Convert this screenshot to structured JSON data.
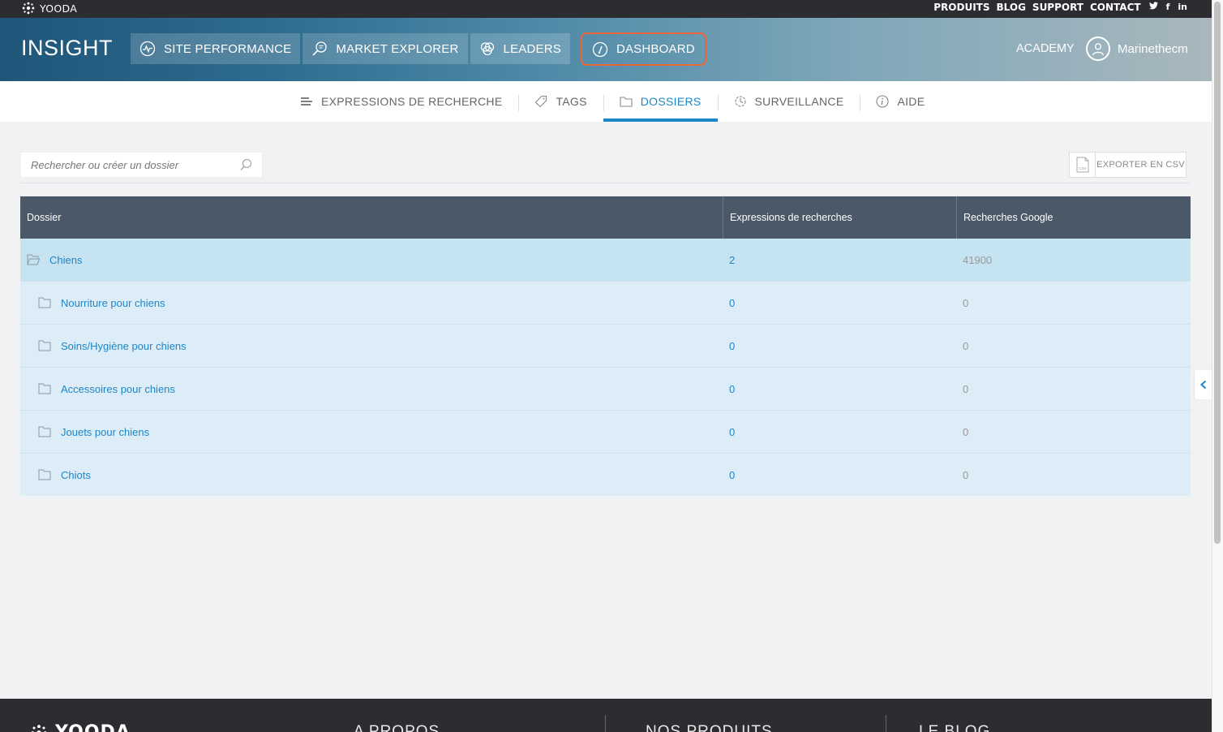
{
  "topbar": {
    "logo_text": "YOODA",
    "links": [
      "PRODUITS",
      "BLOG",
      "SUPPORT",
      "CONTACT"
    ],
    "social": [
      "twitter-icon",
      "facebook-icon",
      "linkedin-icon"
    ],
    "social_glyphs": {
      "twitter": "🐦",
      "facebook": "f",
      "linkedin": "in"
    }
  },
  "header": {
    "brand": "INSIGHT",
    "tabs": [
      {
        "label": "SITE PERFORMANCE",
        "icon": "pulse-icon"
      },
      {
        "label": "MARKET EXPLORER",
        "icon": "magnifier-icon"
      },
      {
        "label": "LEADERS",
        "icon": "circles-icon"
      },
      {
        "label": "DASHBOARD",
        "icon": "gauge-icon",
        "active": true
      }
    ],
    "academy": "ACADEMY",
    "username": "Marinethecm"
  },
  "subnav": {
    "tabs": [
      {
        "label": "EXPRESSIONS DE RECHERCHE",
        "icon": "list-icon"
      },
      {
        "label": "TAGS",
        "icon": "tag-icon"
      },
      {
        "label": "DOSSIERS",
        "icon": "folder-icon",
        "active": true
      },
      {
        "label": "SURVEILLANCE",
        "icon": "watch-icon"
      },
      {
        "label": "AIDE",
        "icon": "info-icon"
      }
    ]
  },
  "search": {
    "placeholder": "Rechercher ou créer un dossier",
    "value": ""
  },
  "export": {
    "label": "EXPORTER EN CSV",
    "icon_text": "CSV"
  },
  "table": {
    "headers": [
      "Dossier",
      "Expressions de recherches",
      "Recherches Google"
    ],
    "rows": [
      {
        "name": "Chiens",
        "expressions": "2",
        "google": "41900",
        "level": "parent"
      },
      {
        "name": "Nourriture pour chiens",
        "expressions": "0",
        "google": "0",
        "level": "child"
      },
      {
        "name": "Soins/Hygiène pour chiens",
        "expressions": "0",
        "google": "0",
        "level": "child"
      },
      {
        "name": "Accessoires pour chiens",
        "expressions": "0",
        "google": "0",
        "level": "child"
      },
      {
        "name": "Jouets pour chiens",
        "expressions": "0",
        "google": "0",
        "level": "child"
      },
      {
        "name": "Chiots",
        "expressions": "0",
        "google": "0",
        "level": "child"
      }
    ]
  },
  "footer": {
    "logo": "YOODA",
    "columns": [
      "A PROPOS",
      "NOS PRODUITS",
      "LE BLOG"
    ]
  },
  "colors": {
    "accent": "#1f86c6",
    "highlight": "#e8663a",
    "header_dark": "#2b2d31",
    "table_head": "#4a5867"
  }
}
